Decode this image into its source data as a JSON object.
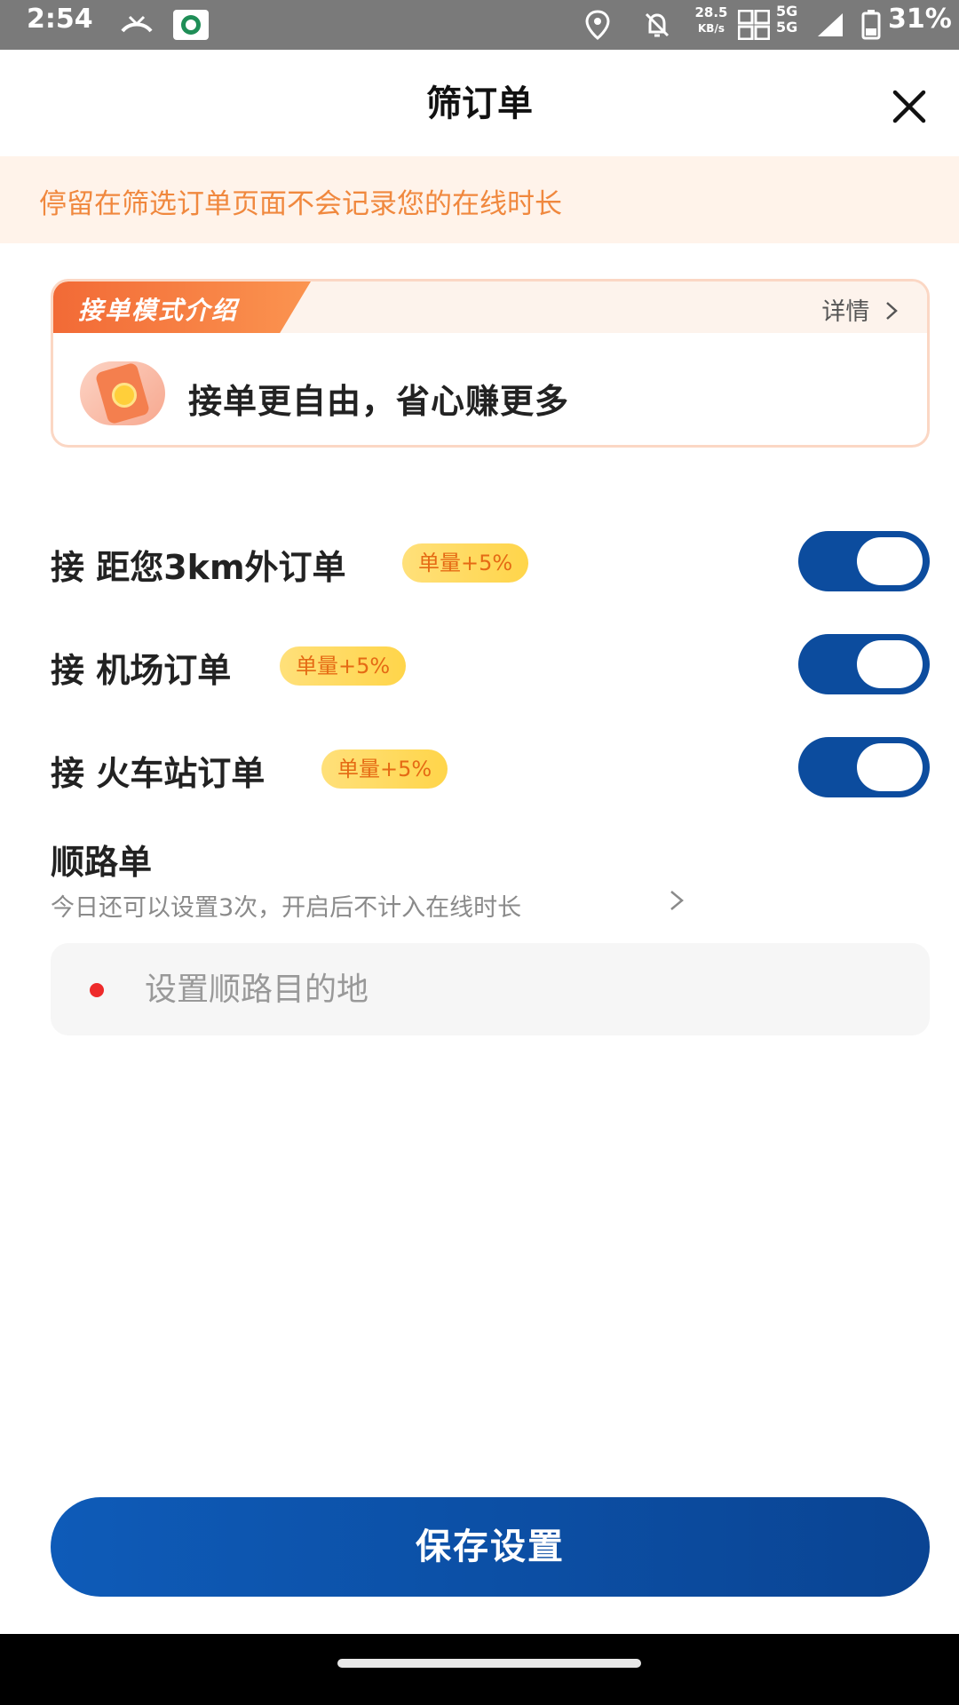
{
  "status_bar": {
    "time": "2:54",
    "net_speed_value": "28.5",
    "net_speed_unit": "KB/s",
    "network_type_1": "5G",
    "network_type_2": "5G",
    "battery_percent": "31%",
    "icons": [
      "call-missed-icon",
      "app-notification-icon",
      "location-icon",
      "mute-icon",
      "volte-icon",
      "signal-icon",
      "battery-icon"
    ]
  },
  "header": {
    "title": "筛订单",
    "close_icon": "close-icon"
  },
  "notice": {
    "text": "停留在筛选订单页面不会记录您的在线时长",
    "color": "#f0883e"
  },
  "intro_card": {
    "tag": "接单模式介绍",
    "detail_label": "详情",
    "slogan": "接单更自由，省心赚更多"
  },
  "order_filters": [
    {
      "label": "接 距您3km外订单",
      "badge": "单量+5%",
      "enabled": true
    },
    {
      "label": "接 机场订单",
      "badge": "单量+5%",
      "enabled": true
    },
    {
      "label": "接 火车站订单",
      "badge": "单量+5%",
      "enabled": true
    }
  ],
  "route": {
    "title": "顺路单",
    "subtitle": "今日还可以设置3次，开启后不计入在线时长",
    "destination_placeholder": "设置顺路目的地"
  },
  "footer": {
    "save_label": "保存设置"
  },
  "colors": {
    "primary": "#0c4c9e",
    "badge_bg": "#ffd54a",
    "badge_text": "#e56a14",
    "accent_orange": "#f26a36"
  }
}
